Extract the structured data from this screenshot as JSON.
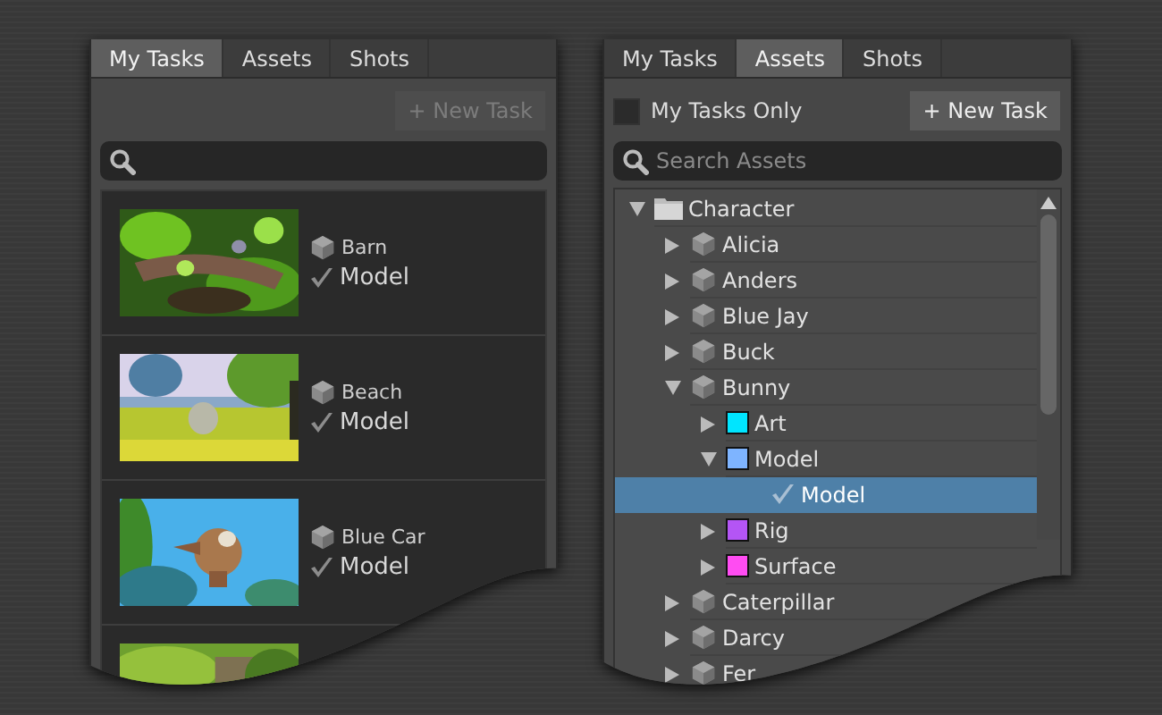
{
  "panels": [
    {
      "tabs": [
        {
          "label": "My Tasks",
          "selected": true
        },
        {
          "label": "Assets",
          "selected": false
        },
        {
          "label": "Shots",
          "selected": false
        }
      ],
      "new_task_button": {
        "label": "+ New Task",
        "disabled": true
      },
      "tasks": [
        {
          "kind": "picture",
          "asset": "Barn",
          "task": "Model"
        },
        {
          "kind": "picture",
          "asset": "Beach",
          "task": "Model"
        },
        {
          "kind": "picture",
          "asset": "Blue Car",
          "task": "Model"
        },
        {
          "kind": "picture"
        }
      ]
    },
    {
      "tabs": [
        {
          "label": "My Tasks",
          "selected": false
        },
        {
          "label": "Assets",
          "selected": true
        },
        {
          "label": "Shots",
          "selected": false
        }
      ],
      "my_tasks_only": {
        "label": "My Tasks Only",
        "checked": false
      },
      "new_task_button": {
        "label": "+ New Task",
        "disabled": false
      },
      "search": {
        "placeholder": "Search Assets"
      },
      "tree": [
        {
          "kind": "folder",
          "label": "Character",
          "expanded": true,
          "selected": false,
          "children": [
            {
              "kind": "asset",
              "label": "Alicia",
              "expanded": false,
              "selected": false
            },
            {
              "kind": "asset",
              "label": "Anders",
              "expanded": false,
              "selected": false
            },
            {
              "kind": "asset",
              "label": "Blue Jay",
              "expanded": false,
              "selected": false
            },
            {
              "kind": "asset",
              "label": "Buck",
              "expanded": false,
              "selected": false
            },
            {
              "kind": "asset",
              "label": "Bunny",
              "expanded": true,
              "selected": false,
              "children": [
                {
                  "kind": "task",
                  "label": "Art",
                  "color": "#00e5ff",
                  "expanded": false,
                  "selected": false
                },
                {
                  "kind": "task",
                  "label": "Model",
                  "color": "#7eb4ff",
                  "expanded": true,
                  "selected": false,
                  "children": [
                    {
                      "kind": "version",
                      "label": "Model",
                      "selected": true
                    }
                  ]
                },
                {
                  "kind": "task",
                  "label": "Rig",
                  "color": "#b455f5",
                  "expanded": false,
                  "selected": false
                },
                {
                  "kind": "task",
                  "label": "Surface",
                  "color": "#ff4cf2",
                  "expanded": false,
                  "selected": false
                }
              ]
            },
            {
              "kind": "asset",
              "label": "Caterpillar",
              "expanded": false,
              "selected": false
            },
            {
              "kind": "asset",
              "label": "Darcy",
              "expanded": false,
              "selected": false
            },
            {
              "kind": "asset",
              "label": "Fer",
              "expanded": false,
              "selected": false
            }
          ]
        }
      ]
    }
  ]
}
